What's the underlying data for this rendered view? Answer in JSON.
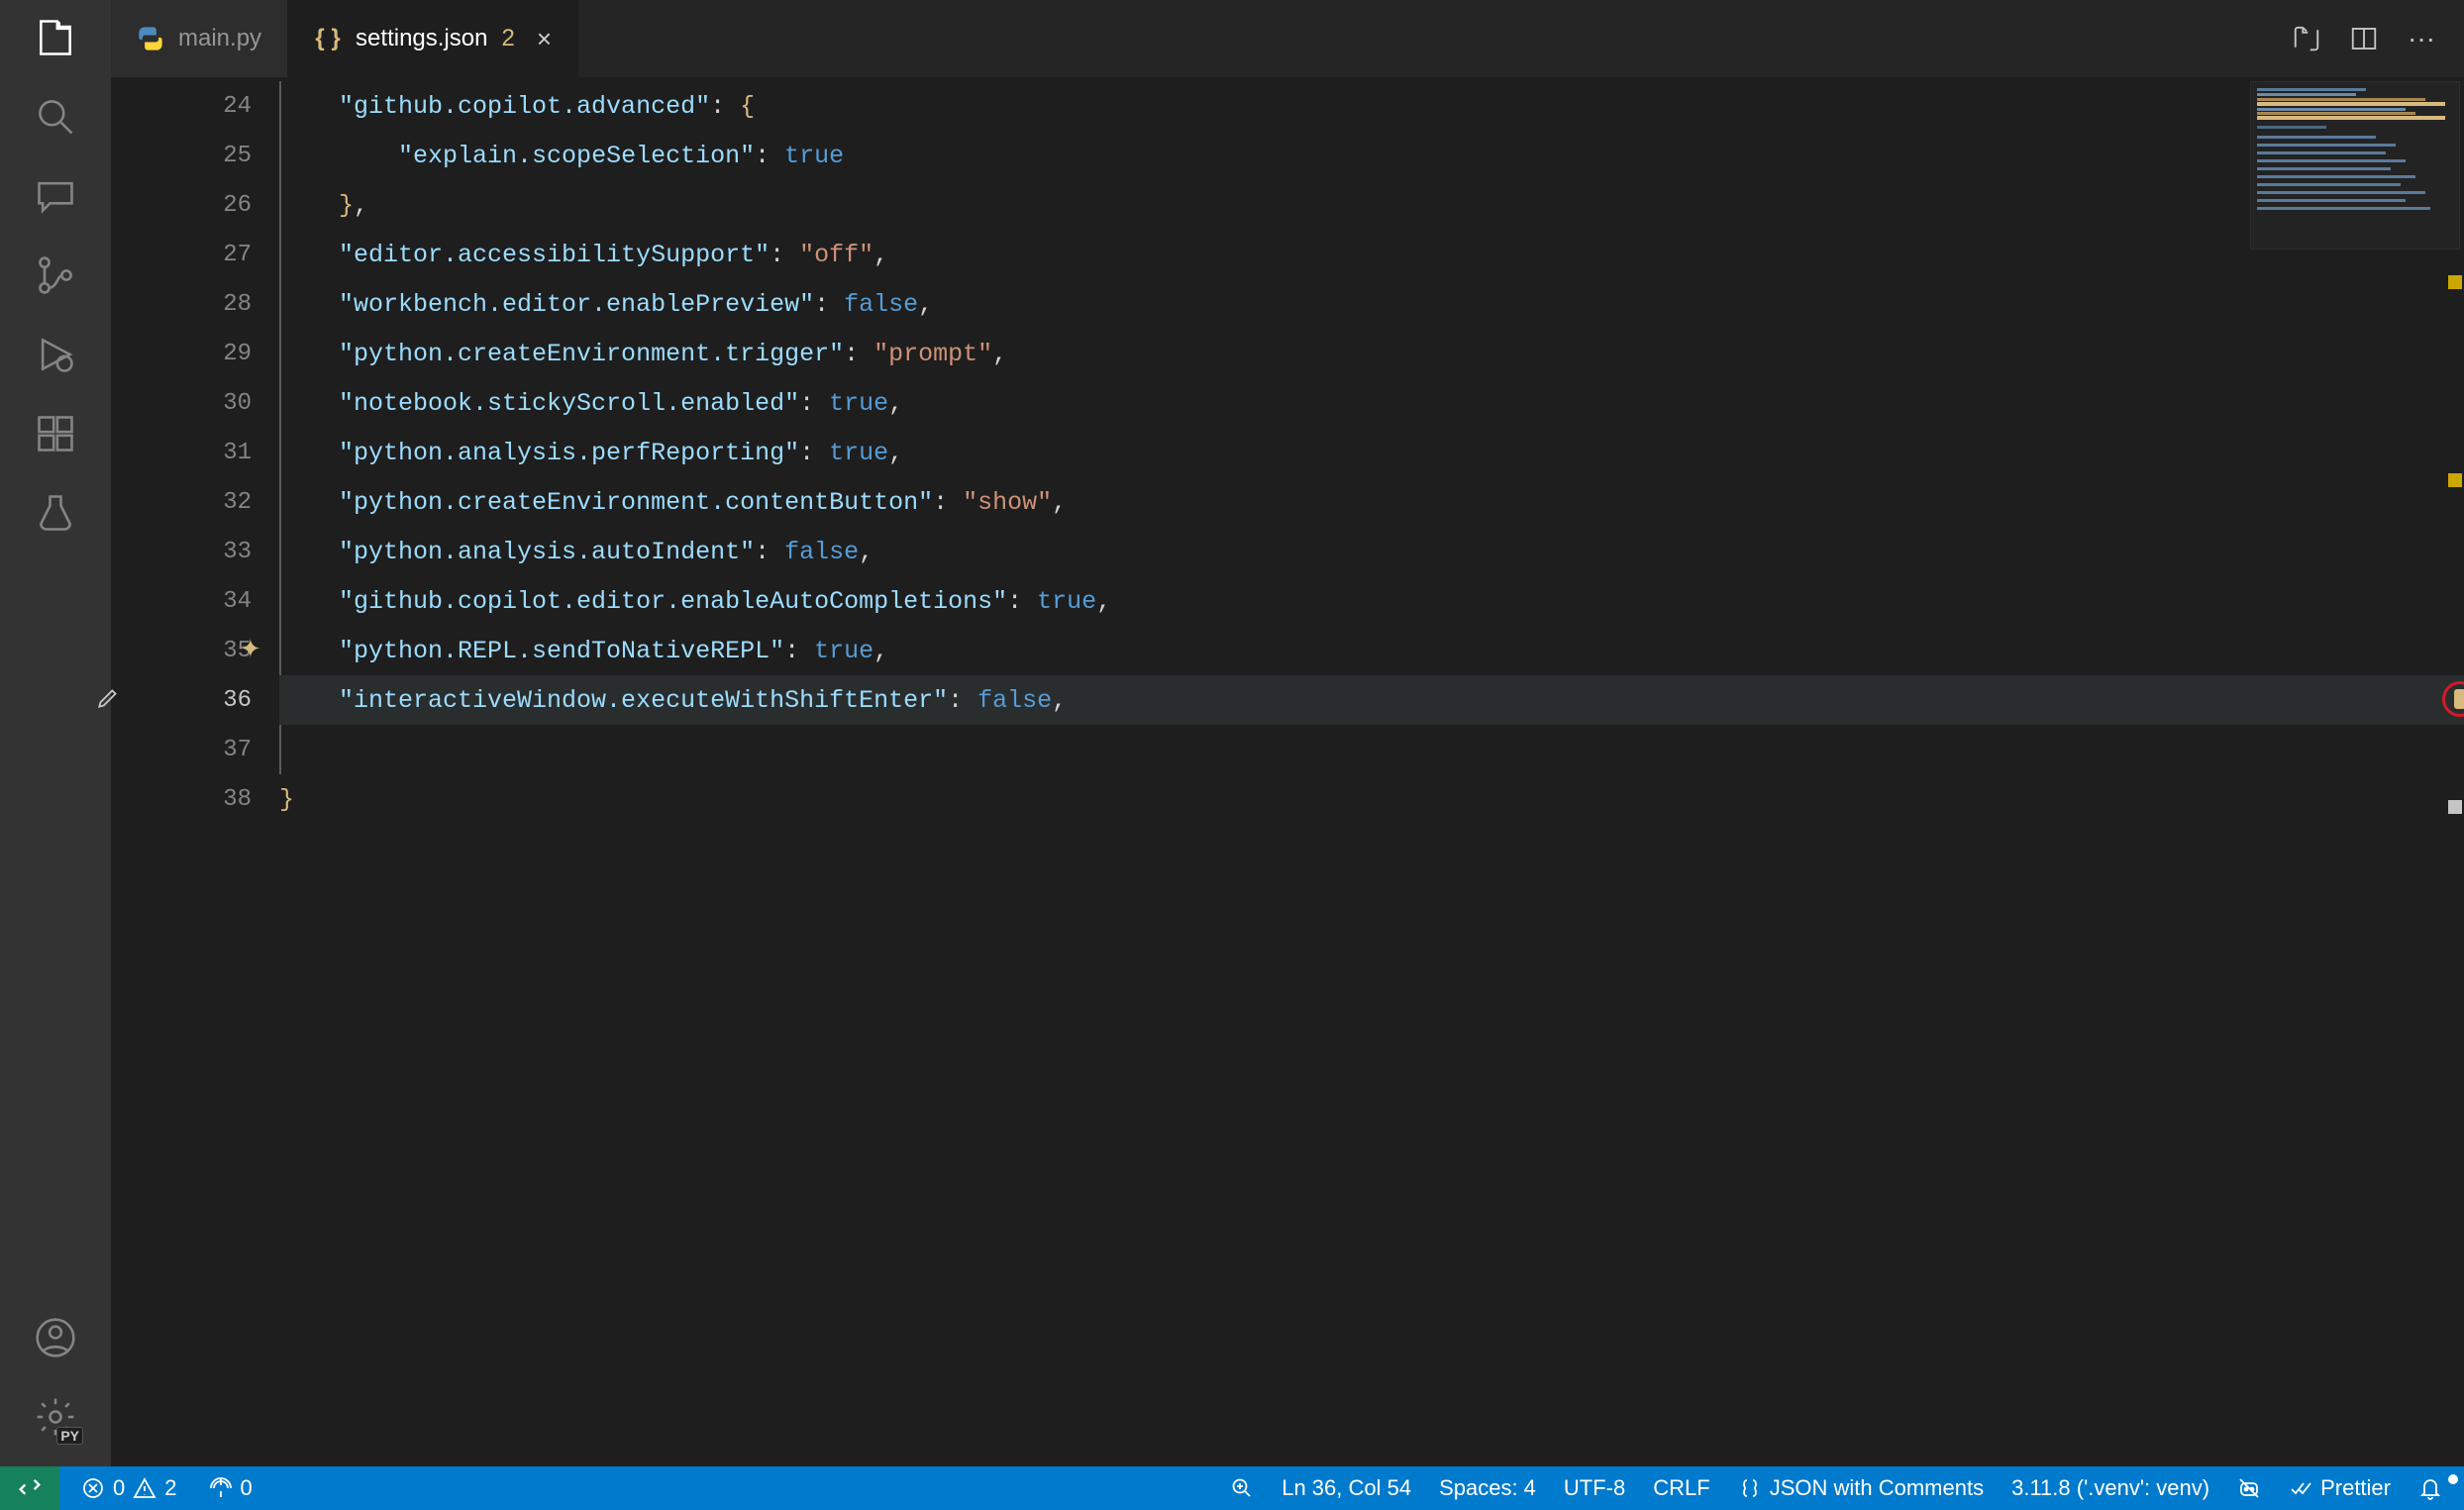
{
  "tabs": [
    {
      "label": "main.py",
      "icon": "python",
      "active": false
    },
    {
      "label": "settings.json",
      "icon": "json",
      "badge": "2",
      "active": true,
      "close": true
    }
  ],
  "editorActions": {
    "compare": "compare-changes",
    "split": "split-editor",
    "more": "more-actions"
  },
  "code": {
    "startLine": 24,
    "currentLine": 36,
    "indent": "    ",
    "indent2": "        ",
    "lines": [
      {
        "n": 24,
        "segs": [
          [
            "prop",
            "\"github.copilot.advanced\""
          ],
          [
            "punc",
            ":"
          ],
          [
            "punc",
            " "
          ],
          [
            "brace",
            "{"
          ]
        ]
      },
      {
        "n": 25,
        "extra": true,
        "segs": [
          [
            "prop",
            "\"explain.scopeSelection\""
          ],
          [
            "punc",
            ":"
          ],
          [
            "punc",
            " "
          ],
          [
            "kw",
            "true"
          ]
        ]
      },
      {
        "n": 26,
        "segs": [
          [
            "brace",
            "}"
          ],
          [
            "punc",
            ","
          ]
        ]
      },
      {
        "n": 27,
        "segs": [
          [
            "prop",
            "\"editor.accessibilitySupport\""
          ],
          [
            "punc",
            ":"
          ],
          [
            "punc",
            " "
          ],
          [
            "str",
            "\"off\""
          ],
          [
            "punc",
            ","
          ]
        ]
      },
      {
        "n": 28,
        "segs": [
          [
            "prop",
            "\"workbench.editor.enablePreview\""
          ],
          [
            "punc",
            ":"
          ],
          [
            "punc",
            " "
          ],
          [
            "kw",
            "false"
          ],
          [
            "punc",
            ","
          ]
        ]
      },
      {
        "n": 29,
        "segs": [
          [
            "prop",
            "\"python.createEnvironment.trigger\""
          ],
          [
            "punc",
            ":"
          ],
          [
            "punc",
            " "
          ],
          [
            "str",
            "\"prompt\""
          ],
          [
            "punc",
            ","
          ]
        ]
      },
      {
        "n": 30,
        "segs": [
          [
            "prop",
            "\"notebook.stickyScroll.enabled\""
          ],
          [
            "punc",
            ":"
          ],
          [
            "punc",
            " "
          ],
          [
            "kw",
            "true"
          ],
          [
            "punc",
            ","
          ]
        ]
      },
      {
        "n": 31,
        "segs": [
          [
            "prop",
            "\"python.analysis.perfReporting\""
          ],
          [
            "punc",
            ":"
          ],
          [
            "punc",
            " "
          ],
          [
            "kw",
            "true"
          ],
          [
            "punc",
            ","
          ]
        ]
      },
      {
        "n": 32,
        "segs": [
          [
            "prop",
            "\"python.createEnvironment.contentButton\""
          ],
          [
            "punc",
            ":"
          ],
          [
            "punc",
            " "
          ],
          [
            "str",
            "\"show\""
          ],
          [
            "punc",
            ","
          ]
        ]
      },
      {
        "n": 33,
        "segs": [
          [
            "prop",
            "\"python.analysis.autoIndent\""
          ],
          [
            "punc",
            ":"
          ],
          [
            "punc",
            " "
          ],
          [
            "kw",
            "false"
          ],
          [
            "punc",
            ","
          ]
        ]
      },
      {
        "n": 34,
        "segs": [
          [
            "prop",
            "\"github.copilot.editor.enableAutoCompletions\""
          ],
          [
            "punc",
            ":"
          ],
          [
            "punc",
            " "
          ],
          [
            "kw",
            "true"
          ],
          [
            "punc",
            ","
          ]
        ]
      },
      {
        "n": 35,
        "sparkle": true,
        "segs": [
          [
            "prop",
            "\"python.REPL.sendToNativeREPL\""
          ],
          [
            "punc",
            ":"
          ],
          [
            "punc",
            " "
          ],
          [
            "kw",
            "true"
          ],
          [
            "punc",
            ","
          ]
        ]
      },
      {
        "n": 36,
        "pencil": true,
        "current": true,
        "segs": [
          [
            "prop",
            "\"interactiveWindow.executeWithShiftEnter\""
          ],
          [
            "punc",
            ":"
          ],
          [
            "punc",
            " "
          ],
          [
            "kw",
            "false"
          ],
          [
            "punc",
            ","
          ]
        ]
      },
      {
        "n": 37,
        "blank": true,
        "segs": []
      },
      {
        "n": 38,
        "outdent": true,
        "segs": [
          [
            "brace",
            "}"
          ]
        ]
      }
    ]
  },
  "cursorMarker": {
    "line": 36
  },
  "statusBar": {
    "errors": "0",
    "warnings": "2",
    "ports": "0",
    "lineCol": "Ln 36, Col 54",
    "spaces": "Spaces: 4",
    "encoding": "UTF-8",
    "eol": "CRLF",
    "language": "JSON with Comments",
    "python": "3.11.8 ('.venv': venv)",
    "prettier": "Prettier"
  },
  "activity": {
    "top": [
      "explorer",
      "search",
      "chat",
      "source-control",
      "run",
      "extensions",
      "testing"
    ],
    "bottom": [
      "accounts",
      "settings-gear"
    ]
  },
  "colors": {
    "accent": "#007acc"
  }
}
